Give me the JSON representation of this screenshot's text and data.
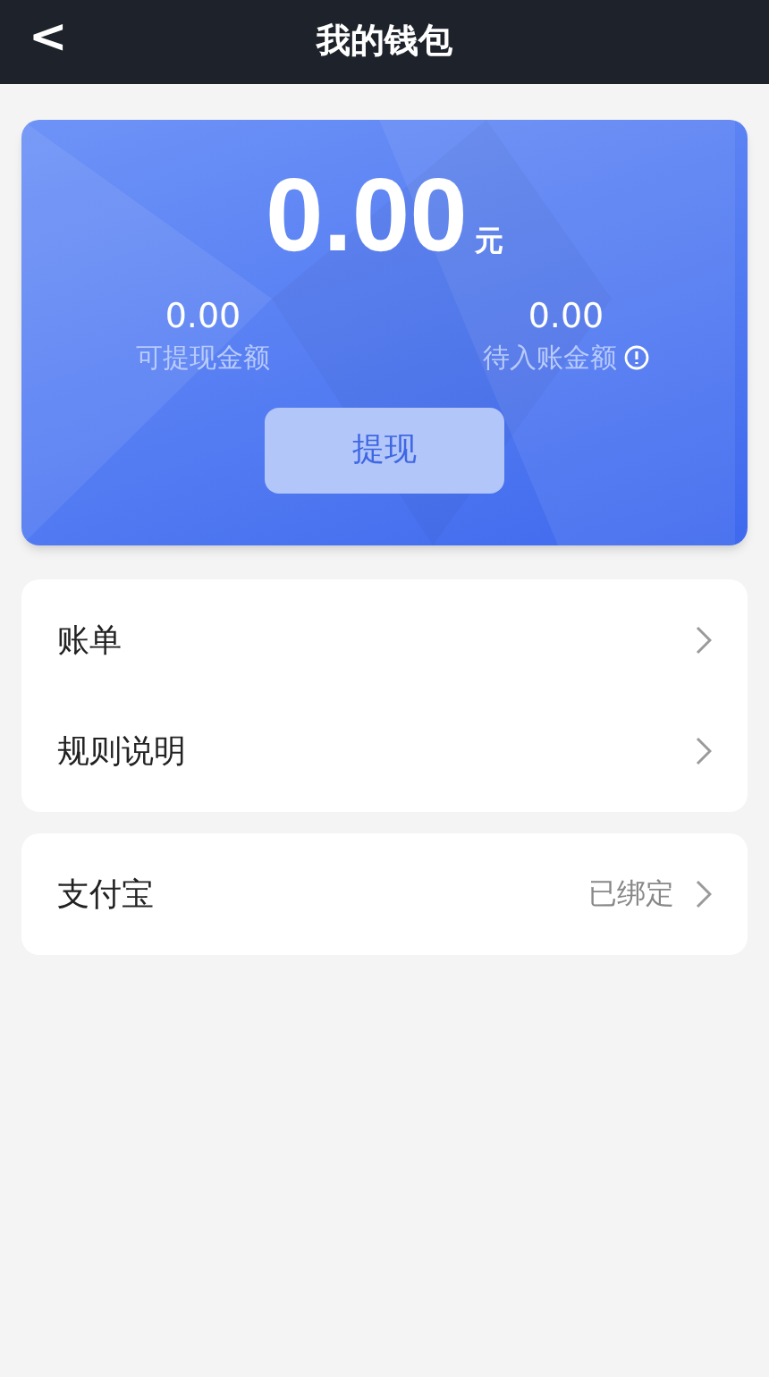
{
  "header": {
    "back": "<",
    "title": "我的钱包"
  },
  "balance": {
    "amount": "0.00",
    "unit": "元"
  },
  "stats": [
    {
      "value": "0.00",
      "label": "可提现金额",
      "info": false
    },
    {
      "value": "0.00",
      "label": "待入账金额",
      "info": true
    }
  ],
  "withdraw_button": "提现",
  "menu_groups": [
    [
      {
        "label": "账单"
      },
      {
        "label": "规则说明"
      }
    ],
    [
      {
        "label": "支付宝",
        "status": "已绑定"
      }
    ]
  ]
}
